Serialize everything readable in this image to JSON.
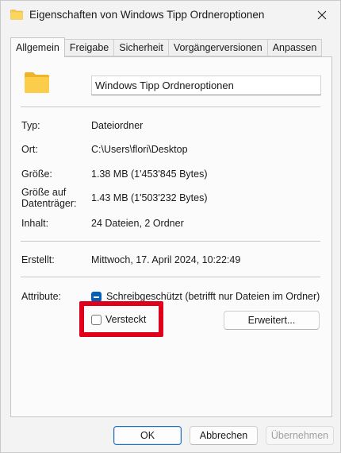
{
  "window": {
    "title": "Eigenschaften von Windows Tipp Ordneroptionen"
  },
  "tabs": [
    {
      "label": "Allgemein",
      "active": true
    },
    {
      "label": "Freigabe",
      "active": false
    },
    {
      "label": "Sicherheit",
      "active": false
    },
    {
      "label": "Vorgängerversionen",
      "active": false
    },
    {
      "label": "Anpassen",
      "active": false
    }
  ],
  "general": {
    "folder_name": "Windows Tipp Ordneroptionen",
    "type_label": "Typ:",
    "type_value": "Dateiordner",
    "location_label": "Ort:",
    "location_value": "C:\\Users\\flori\\Desktop",
    "size_label": "Größe:",
    "size_value": "1.38 MB (1'453'845 Bytes)",
    "disk_size_label_1": "Größe auf",
    "disk_size_label_2": "Datenträger:",
    "disk_size_value": "1.43 MB (1'503'232 Bytes)",
    "contents_label": "Inhalt:",
    "contents_value": "24 Dateien, 2 Ordner",
    "created_label": "Erstellt:",
    "created_value": "Mittwoch, 17. April 2024, 10:22:49",
    "attributes_label": "Attribute:",
    "readonly_label": "Schreibgeschützt (betrifft nur Dateien im Ordner)",
    "readonly_checked": true,
    "hidden_label": "Versteckt",
    "hidden_checked": false,
    "advanced_button": "Erweitert..."
  },
  "footer": {
    "ok": "OK",
    "cancel": "Abbrechen",
    "apply": "Übernehmen"
  },
  "colors": {
    "accent": "#005fb8",
    "highlight": "#e0001b",
    "folder": "#f8c946"
  },
  "icons": {
    "title": "folder-icon",
    "close": "close-icon",
    "folder_large": "folder-icon"
  }
}
